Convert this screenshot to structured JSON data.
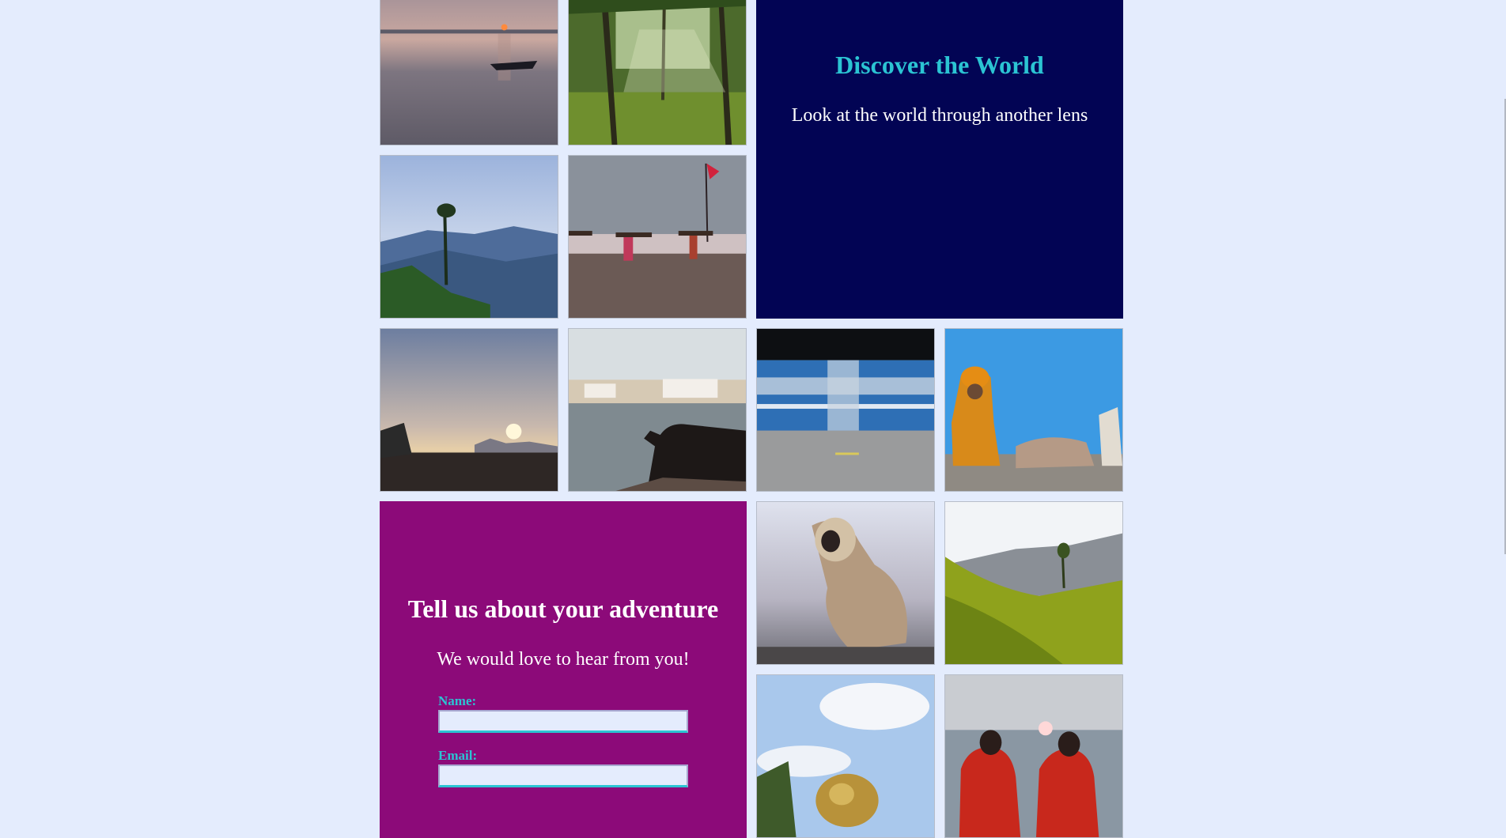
{
  "discover": {
    "title": "Discover the World",
    "subtitle": "Look at the world through another lens"
  },
  "adventure": {
    "title": "Tell us about your adventure",
    "subtitle": "We would love to hear from you!",
    "name_label": "Name:",
    "email_label": "Email:",
    "name_value": "",
    "email_value": ""
  },
  "colors": {
    "page_background": "#e4ecfd",
    "discover_panel": "#020454",
    "adventure_panel": "#8c0a79",
    "accent": "#2bc4d3"
  },
  "photos": [
    "sunset-boat-on-lake",
    "palm-grove",
    "misty-blue-hills",
    "women-carrying-wood-on-beach",
    "sunset-over-mudflats",
    "cow-by-lakeside-town",
    "blurred-blue-train",
    "sadhu-against-blue-wall",
    "langur-monkey",
    "tea-plantation",
    "golden-dome-and-clouds",
    "two-women-in-red-at-sea"
  ]
}
